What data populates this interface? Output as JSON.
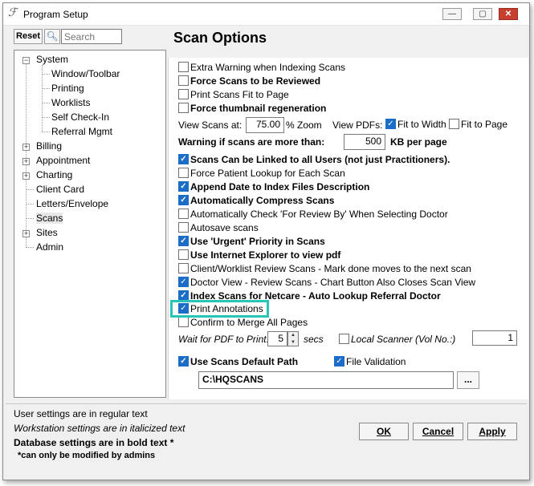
{
  "window": {
    "title": "Program Setup",
    "minimize_glyph": "—",
    "maximize_glyph": "▢",
    "close_glyph": "✕"
  },
  "search": {
    "reset_label": "Reset",
    "placeholder": "Search",
    "icon": "magnifier-icon"
  },
  "tree": {
    "items": [
      {
        "label": "System",
        "expander": "−"
      },
      {
        "label": "Window/Toolbar"
      },
      {
        "label": "Printing"
      },
      {
        "label": "Worklists"
      },
      {
        "label": "Self Check-In"
      },
      {
        "label": "Referral Mgmt"
      },
      {
        "label": "Billing",
        "expander": "+"
      },
      {
        "label": "Appointment",
        "expander": "+"
      },
      {
        "label": "Charting",
        "expander": "+"
      },
      {
        "label": "Client Card"
      },
      {
        "label": "Letters/Envelope"
      },
      {
        "label": "Scans",
        "selected": true
      },
      {
        "label": "Sites",
        "expander": "+"
      },
      {
        "label": "Admin"
      }
    ]
  },
  "panel": {
    "title": "Scan Options"
  },
  "options": {
    "extra_warning": {
      "label": "Extra Warning when Indexing Scans",
      "checked": false
    },
    "force_review": {
      "label": "Force Scans to be Reviewed",
      "checked": false
    },
    "print_fit": {
      "label": "Print Scans Fit to Page",
      "checked": false
    },
    "force_thumb": {
      "label": "Force thumbnail regeneration",
      "checked": false
    },
    "view_scans_label": "View Scans at:",
    "view_scans_value": "75.00",
    "zoom_label": "% Zoom",
    "view_pdfs_label": "View PDFs:",
    "fit_width": {
      "label": "Fit to Width",
      "checked": true
    },
    "fit_page": {
      "label": "Fit to Page",
      "checked": false
    },
    "warning_label": "Warning if scans are more than:",
    "warning_value": "500",
    "kb_label": "KB per page",
    "link_all_users": {
      "label": "Scans Can be Linked to all Users (not just Practitioners).",
      "checked": true
    },
    "force_patient_lookup": {
      "label": "Force Patient Lookup for Each Scan",
      "checked": false
    },
    "append_date": {
      "label": "Append Date to Index Files Description",
      "checked": true
    },
    "auto_compress": {
      "label": "Automatically Compress Scans",
      "checked": true
    },
    "auto_check_review": {
      "label": "Automatically Check 'For Review By' When Selecting Doctor",
      "checked": false
    },
    "autosave": {
      "label": "Autosave scans",
      "checked": false
    },
    "urgent_priority": {
      "label": "Use 'Urgent' Priority in Scans",
      "checked": true
    },
    "use_ie": {
      "label": "Use Internet Explorer to view pdf",
      "checked": false
    },
    "client_worklist": {
      "label": "Client/Worklist Review Scans - Mark done moves to the next scan",
      "checked": false
    },
    "doctor_view": {
      "label": "Doctor View - Review Scans - Chart Button Also Closes Scan View",
      "checked": true
    },
    "index_netcare": {
      "label": "Index Scans for Netcare - Auto Lookup Referral Doctor",
      "checked": true
    },
    "print_annotations": {
      "label": "Print Annotations",
      "checked": true
    },
    "confirm_merge": {
      "label": "Confirm to Merge All Pages",
      "checked": false
    },
    "wait_pdf_label": "Wait for PDF to Print:",
    "wait_pdf_value": "5",
    "secs_label": "secs",
    "local_scanner": {
      "label": "Local Scanner (Vol No.:)",
      "checked": false
    },
    "local_scanner_value": "1",
    "default_path": {
      "label": "Use Scans Default Path",
      "checked": true
    },
    "file_validation": {
      "label": "File Validation",
      "checked": true
    },
    "path_value": "C:\\HQSCANS",
    "browse_label": "..."
  },
  "legend": {
    "regular": "User settings are in regular text",
    "italic": "Workstation settings are in italicized text",
    "bold": "Database settings are in bold text *",
    "note": "*can only be modified by admins"
  },
  "buttons": {
    "ok": "OK",
    "cancel": "Cancel",
    "apply": "Apply"
  },
  "colors": {
    "checkbox_checked": "#1b6dc7",
    "highlight": "#29c4b8",
    "close_button": "#c7402f"
  }
}
